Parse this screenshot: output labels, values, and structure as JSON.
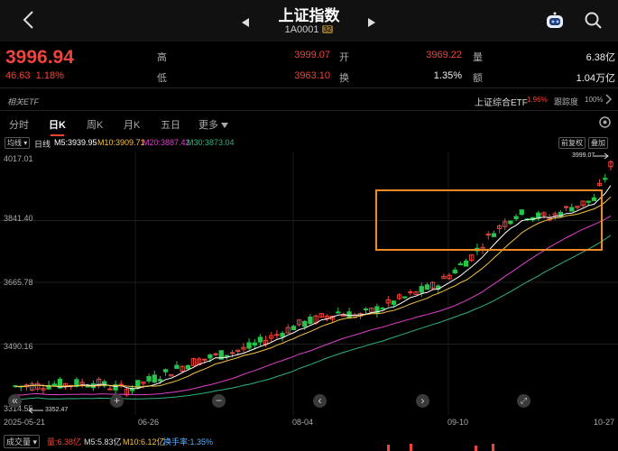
{
  "header": {
    "back_icon": "chevron-left-icon",
    "title": "上证指数",
    "code": "1A0001",
    "code_badge": "32",
    "prev_icon": "triangle-left-icon",
    "next_icon": "triangle-right-icon",
    "robot_icon": "robot-icon",
    "search_icon": "search-icon"
  },
  "quote": {
    "price": "3996.94",
    "change": "46.63",
    "change_pct": "1.18%",
    "high_label": "高",
    "high": "3999.07",
    "open_label": "开",
    "open": "3969.22",
    "volume_label": "量",
    "volume": "6.38亿",
    "low_label": "低",
    "low": "3963.10",
    "turnover_label": "换",
    "turnover": "1.35%",
    "amount_label": "额",
    "amount": "1.04万亿",
    "up_color": "#f0433a"
  },
  "etf": {
    "left_label": "相关ETF",
    "right_label": "上证综合ETF",
    "right_pct": "1.96%",
    "track_label": "跟踪度",
    "track_value": "100%"
  },
  "tabs": [
    {
      "label": "分时",
      "active": false
    },
    {
      "label": "日K",
      "active": true
    },
    {
      "label": "周K",
      "active": false
    },
    {
      "label": "月K",
      "active": false
    },
    {
      "label": "五日",
      "active": false
    },
    {
      "label": "更多",
      "active": false
    }
  ],
  "ma_bar": {
    "select": "均线",
    "period": "日线",
    "ma5": "M5:3939.95",
    "ma10": "M10:3909.71",
    "ma20": "M20:3887.42",
    "ma30": "M30:3873.04",
    "adjust": "前复权",
    "overlay": "叠加",
    "ma5_color": "#ffffff",
    "ma10_color": "#f5c242",
    "ma20_color": "#e040c8",
    "ma30_color": "#2fb37e"
  },
  "chart_data": {
    "type": "candlestick",
    "y_ticks": [
      "4017.01",
      "3841.40",
      "3665.78",
      "3490.16",
      "3314.55"
    ],
    "x_ticks": [
      "2025-05-21",
      "06-26",
      "08-04",
      "09-10",
      "10-27"
    ],
    "ylim": [
      3314.55,
      4017.01
    ],
    "max_label": "3999.07",
    "min_label": "3352.47",
    "highlight_box": "orange"
  },
  "bottom": {
    "select": "成交量",
    "vol": "量:6.38亿",
    "m5": "M5:5.83亿",
    "m10": "M10:6.12亿",
    "turnover": "换手率:1.35%"
  }
}
